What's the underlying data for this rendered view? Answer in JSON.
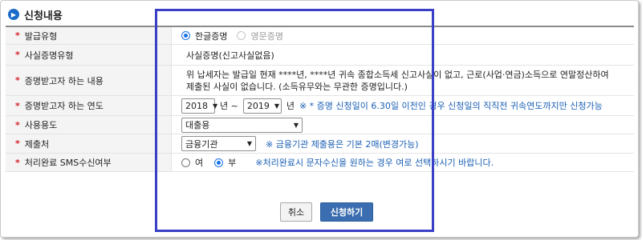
{
  "header": {
    "title": "신청내용",
    "icon": "chevron-right-icon"
  },
  "form": {
    "star": "*",
    "rows": [
      {
        "label": "발급유형"
      },
      {
        "label": "사실증명유형"
      },
      {
        "label": "증명받고자 하는 내용"
      },
      {
        "label": "증명받고자 하는 연도"
      },
      {
        "label": "사용용도"
      },
      {
        "label": "제출처"
      },
      {
        "label": "처리완료 SMS수신여부"
      }
    ],
    "issue_type": {
      "korean": "한글증명",
      "english": "영문증명"
    },
    "fact_type": "사실증명(신고사실없음)",
    "content": "위 납세자는 발급일 현재 ****년, ****년 귀속 종합소득세 신고사실이 없고, 근로(사업·연금)소득으로 연말정산하여 제출된 사실이 없습니다. (소득유무와는 무관한 증명입니다.)",
    "year": {
      "from": "2018",
      "sep1": "년 ~",
      "to": "2019",
      "sep2": "년",
      "note": "※ * 증명 신청일이 6.30일 이전인 경우 신청일의 직직전 귀속연도까지만 신청가능"
    },
    "purpose": "대출용",
    "submit_to": {
      "value": "금융기관",
      "note": "※ 금융기관 제출용은 기본 2매(변경가능)"
    },
    "sms": {
      "yes": "여",
      "no": "부",
      "note": "※처리완료시 문자수신을 원하는 경우 여로 선택하시기 바랍니다."
    }
  },
  "buttons": {
    "cancel": "취소",
    "submit": "신청하기"
  },
  "colors": {
    "accent": "#1b6cc8",
    "required": "#d2232a",
    "note": "#1a5fb4",
    "highlight": "#3a40c6"
  }
}
